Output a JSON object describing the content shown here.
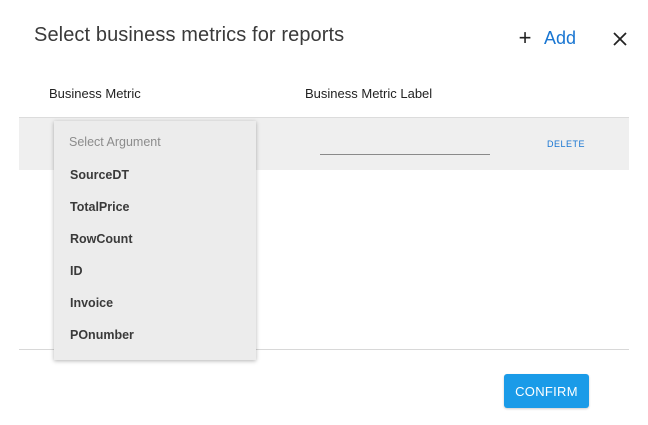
{
  "dialog": {
    "title": "Select business metrics for reports",
    "add_label": "Add",
    "confirm_label": "CONFIRM"
  },
  "table": {
    "columns": [
      "Business Metric",
      "Business Metric Label"
    ],
    "row": {
      "label_value": "",
      "delete_label": "DELETE"
    }
  },
  "dropdown": {
    "placeholder": "Select Argument",
    "options": [
      "SourceDT",
      "TotalPrice",
      "RowCount",
      "ID",
      "Invoice",
      "POnumber"
    ]
  },
  "colors": {
    "accent": "#1976d2",
    "button": "#1a9be8",
    "row_bg": "#efefef"
  },
  "icons": {
    "add": "plus-icon",
    "close": "close-icon"
  }
}
